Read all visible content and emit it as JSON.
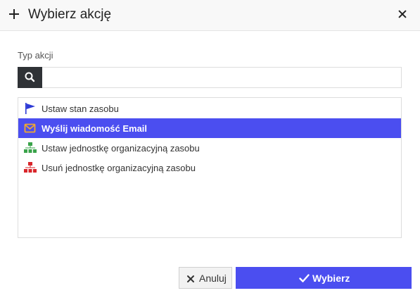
{
  "dialog": {
    "title": "Wybierz akcję",
    "add_icon": "plus-icon",
    "close_icon": "close-icon"
  },
  "field": {
    "label": "Typ akcji",
    "search_icon": "search-icon",
    "search_value": "",
    "search_placeholder": ""
  },
  "actions": {
    "items": [
      {
        "label": "Ustaw stan zasobu",
        "icon": "flag-icon",
        "selected": false
      },
      {
        "label": "Wyślij wiadomość Email",
        "icon": "envelope-icon",
        "selected": true
      },
      {
        "label": "Ustaw jednostkę organizacyjną zasobu",
        "icon": "org-chart-green-icon",
        "selected": false
      },
      {
        "label": "Usuń jednostkę organizacyjną zasobu",
        "icon": "org-chart-red-icon",
        "selected": false
      }
    ]
  },
  "footer": {
    "cancel_label": "Anuluj",
    "cancel_icon": "x-icon",
    "confirm_label": "Wybierz",
    "confirm_icon": "checkmark-icon"
  },
  "colors": {
    "accent": "#4b4ef0",
    "flag": "#2e3bd6",
    "envelope": "#f0a830",
    "org_add": "#3aa34a",
    "org_remove": "#d9262b"
  }
}
